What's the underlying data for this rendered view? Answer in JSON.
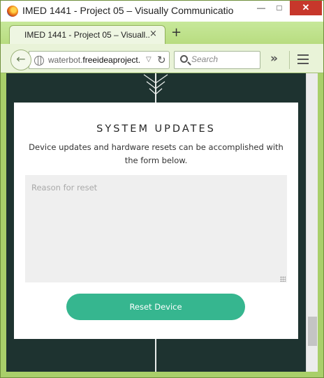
{
  "window": {
    "title": "IMED 1441 - Project 05 – Visually Communicatio",
    "minimize_glyph": "—",
    "maximize_glyph": "□",
    "close_glyph": "✕"
  },
  "tabs": [
    {
      "title": "IMED 1441 - Project 05 – Visuall...",
      "close_glyph": "×",
      "active": true
    }
  ],
  "new_tab_glyph": "+",
  "navbar": {
    "back_glyph": "←",
    "url_prefix": "waterbot.",
    "url_host": "freeideaproject.",
    "dropdown_glyph": "▽",
    "reload_glyph": "↻",
    "search_placeholder": "Search",
    "overflow_glyph": "»"
  },
  "icons": {
    "app": "firefox-icon",
    "globe": "globe-icon",
    "search": "search-icon",
    "menu": "hamburger-menu-icon",
    "decoration": "chevron-arrows-icon"
  },
  "page": {
    "section_title": "SYSTEM UPDATES",
    "description": "Device updates and hardware resets can be accomplished with the form below.",
    "reason_placeholder": "Reason for reset",
    "reason_value": "",
    "reset_button_label": "Reset Device"
  },
  "colors": {
    "page_background": "#1e3330",
    "button_accent": "#36b68f",
    "browser_chrome": "#a9cf6a",
    "close_button": "#c7372b"
  },
  "scroll_position": 0.88
}
